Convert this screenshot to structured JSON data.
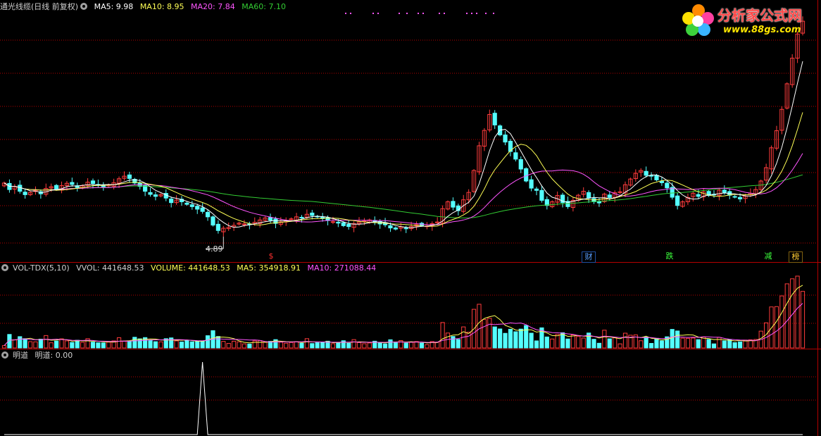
{
  "main_header": {
    "title": "通光线缆(日线 前复权)",
    "ma5": "MA5: 9.98",
    "ma10": "MA10: 8.95",
    "ma20": "MA20: 7.84",
    "ma60": "MA60: 7.10"
  },
  "volume_header": {
    "title": "VOL-TDX(5,10)",
    "vvol": "VVOL: 441648.53",
    "volume": "VOLUME: 441648.53",
    "ma5": "MA5: 354918.91",
    "ma10": "MA10: 271088.44"
  },
  "indicator_header": {
    "title": "明道",
    "value": "明道: 0.00"
  },
  "low_marker": "4.89",
  "event_tags": [
    {
      "label": "$",
      "color": "#ff3030"
    },
    {
      "label": "财",
      "color": "#5aa0ff"
    },
    {
      "label": "跌",
      "color": "#3cff3c"
    },
    {
      "label": "减",
      "color": "#3cff3c"
    },
    {
      "label": "榜",
      "color": "#ffcc33"
    }
  ],
  "logo": {
    "name": "分析家公式网",
    "url": "www.88gs.com"
  },
  "colors": {
    "up": "#ff3c3c",
    "down": "#54ffff",
    "ma5": "#ffffff",
    "ma10": "#ffff55",
    "ma20": "#ff55ff",
    "ma60": "#33cc33",
    "grid": "#b40000"
  },
  "chart_data": [
    {
      "type": "candlestick",
      "title": "通光线缆(日线 前复权)",
      "price_range": [
        4.6,
        12.7
      ],
      "ma_last": {
        "MA5": 9.98,
        "MA10": 8.95,
        "MA20": 7.84,
        "MA60": 7.1
      },
      "annotated_low": 4.89,
      "closes": [
        6.71,
        6.48,
        6.59,
        6.42,
        6.3,
        6.38,
        6.45,
        6.33,
        6.52,
        6.58,
        6.49,
        6.62,
        6.7,
        6.66,
        6.55,
        6.61,
        6.74,
        6.69,
        6.63,
        6.58,
        6.64,
        6.72,
        6.86,
        6.95,
        6.87,
        6.71,
        6.59,
        6.42,
        6.31,
        6.24,
        6.3,
        6.18,
        6.02,
        6.11,
        6.05,
        5.96,
        5.88,
        5.79,
        5.71,
        5.52,
        5.23,
        5.04,
        5.12,
        5.15,
        5.22,
        5.3,
        5.27,
        5.25,
        5.33,
        5.41,
        5.48,
        5.4,
        5.29,
        5.34,
        5.39,
        5.45,
        5.52,
        5.49,
        5.61,
        5.57,
        5.52,
        5.46,
        5.39,
        5.35,
        5.3,
        5.21,
        5.18,
        5.28,
        5.34,
        5.37,
        5.41,
        5.34,
        5.27,
        5.24,
        5.13,
        5.09,
        5.17,
        5.12,
        5.18,
        5.25,
        5.22,
        5.2,
        5.28,
        5.34,
        5.81,
        6.05,
        5.86,
        5.74,
        6.12,
        6.38,
        7.15,
        8.02,
        8.56,
        9.12,
        8.75,
        8.4,
        8.15,
        7.82,
        7.55,
        7.2,
        6.78,
        6.53,
        6.45,
        6.1,
        5.92,
        6.05,
        6.27,
        6.02,
        5.88,
        6.1,
        6.28,
        6.42,
        6.18,
        6.05,
        6.01,
        6.32,
        6.2,
        6.37,
        6.4,
        6.65,
        6.85,
        7.05,
        7.15,
        6.98,
        6.95,
        6.82,
        6.72,
        6.54,
        6.21,
        5.92,
        6.05,
        6.2,
        6.35,
        6.24,
        6.4,
        6.27,
        6.3,
        6.46,
        6.38,
        6.28,
        6.22,
        6.15,
        6.25,
        6.35,
        6.48,
        6.78,
        7.25,
        7.95,
        8.55,
        9.3,
        10.2,
        11.1,
        11.95,
        12.4
      ]
    },
    {
      "type": "bar",
      "title": "VOL-TDX(5,10)",
      "last_volume": 441648.53,
      "ma5": 354918.91,
      "ma10": 271088.44
    },
    {
      "type": "line",
      "title": "明道",
      "last_value": 0.0
    }
  ]
}
